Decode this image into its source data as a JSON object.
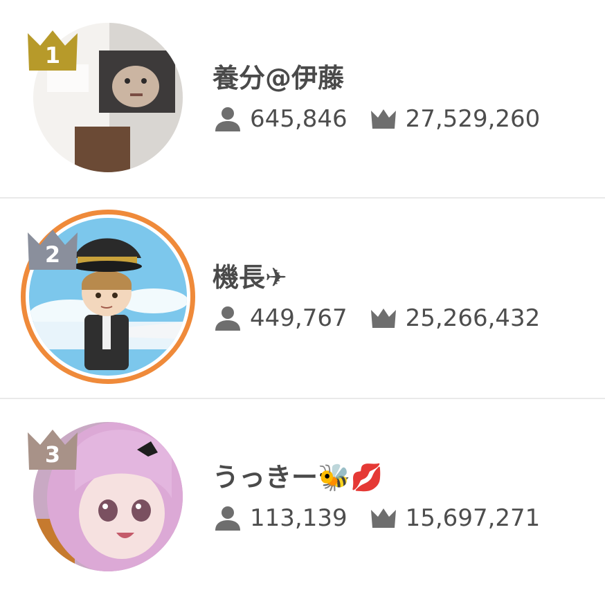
{
  "ranking": [
    {
      "rank": "1",
      "name": "養分@伊藤",
      "followers": "645,846",
      "points": "27,529,260",
      "crown_color": "#b79a2a",
      "avatar": "photo-avatar"
    },
    {
      "rank": "2",
      "name": "機長✈",
      "followers": "449,767",
      "points": "25,266,432",
      "crown_color": "#8a8f9c",
      "avatar": "pilot-avatar",
      "ring_color": "#ef8a3a"
    },
    {
      "rank": "3",
      "name": "うっきー🐝💋",
      "followers": "113,139",
      "points": "15,697,271",
      "crown_color": "#a89288",
      "avatar": "anime-girl-avatar"
    }
  ],
  "icons": {
    "followers": "person-icon",
    "points": "crown-icon"
  },
  "colors": {
    "text": "#4a4a4a",
    "icon": "#6e6e6e",
    "divider": "#e9e9e9"
  }
}
